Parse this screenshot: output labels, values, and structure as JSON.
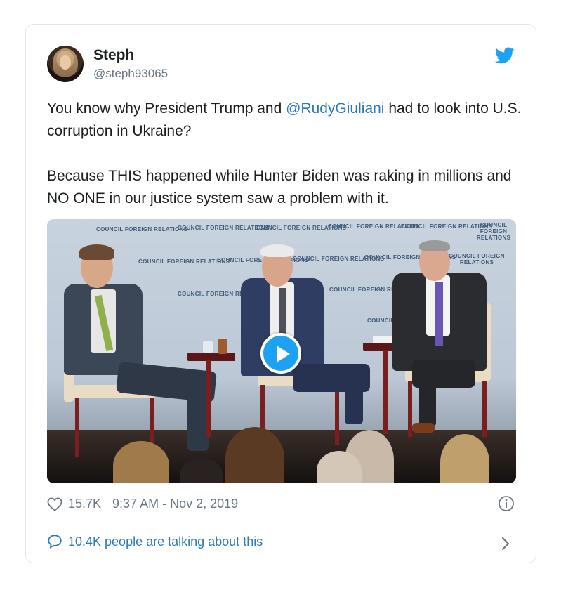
{
  "tweet": {
    "display_name": "Steph",
    "handle": "@steph93065",
    "text_p1_before": "You know why President Trump and ",
    "mention": "@RudyGiuliani",
    "text_p1_after": " had to look into U.S. corruption in Ukraine?",
    "text_p2": "Because THIS happened while Hunter Biden was raking in millions and NO ONE in our justice system saw a problem with it.",
    "likes": "15.7K",
    "timestamp": "9:37 AM - Nov 2, 2019",
    "conversation": "10.4K people are talking about this"
  },
  "media": {
    "backdrop_text": "COUNCIL FOREIGN RELATIONS"
  },
  "icons": {
    "bird": "twitter-bird-icon",
    "heart": "heart-icon",
    "info": "info-icon",
    "bubble": "speech-bubble-icon",
    "chevron": "chevron-right-icon",
    "play": "play-icon"
  },
  "colors": {
    "brand": "#1da1f2",
    "link": "#2b7bb9",
    "muted": "#697882",
    "text": "#1c2022"
  }
}
